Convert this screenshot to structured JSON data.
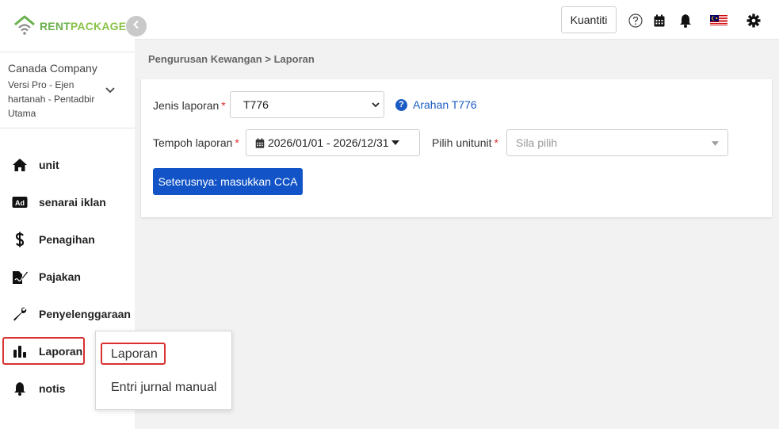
{
  "brand": {
    "rent": "RENT",
    "package": "PACKAGE"
  },
  "company": {
    "name": "Canada Company",
    "line1": "Versi Pro - Ejen",
    "line2": "hartanah - Pentadbir",
    "line3": "Utama"
  },
  "nav": {
    "items": [
      {
        "label": "unit",
        "icon": "home-icon"
      },
      {
        "label": "senarai iklan",
        "icon": "ad-icon"
      },
      {
        "label": "Penagihan",
        "icon": "dollar-icon"
      },
      {
        "label": "Pajakan",
        "icon": "lease-icon"
      },
      {
        "label": "Penyelenggaraan",
        "icon": "wrench-icon"
      },
      {
        "label": "Laporan",
        "icon": "bar-chart-icon"
      },
      {
        "label": "notis",
        "icon": "bell-icon"
      }
    ]
  },
  "topbar": {
    "kuantiti_label": "Kuantiti",
    "icons": [
      "help-icon",
      "calendar-icon",
      "bell-icon",
      "malaysia-flag-icon",
      "gear-icon"
    ]
  },
  "breadcrumb": "Pengurusan Kewangan > Laporan",
  "form": {
    "report_type_label": "Jenis laporan",
    "report_type_value": "T776",
    "help_link": "Arahan T776",
    "period_label": "Tempoh laporan",
    "period_value": "2026/01/01 - 2026/12/31",
    "unit_label": "Pilih unitunit",
    "unit_placeholder": "Sila pilih",
    "next_button": "Seterusnya: masukkan CCA",
    "required_mark": "*"
  },
  "dropdown_menu": {
    "items": [
      "Laporan",
      "Entri jurnal manual"
    ]
  },
  "colors": {
    "primary": "#1254c7",
    "highlight": "#d93030",
    "brand_green": "#6ab04c"
  }
}
